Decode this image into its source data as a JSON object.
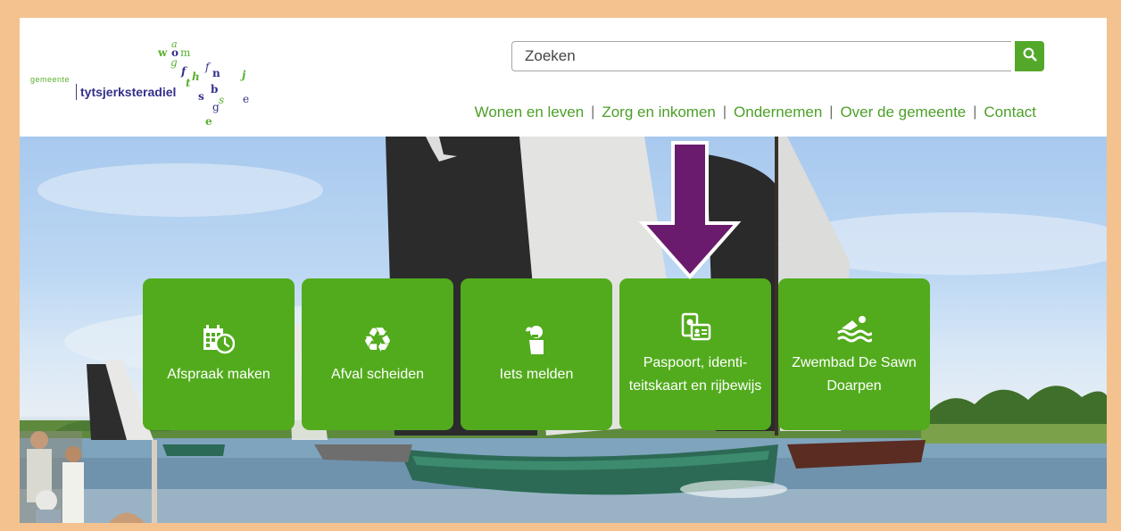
{
  "logo": {
    "prefix": "gemeente",
    "name": "tytsjerksteradiel",
    "letters": [
      "w",
      "a",
      "o",
      "m",
      "g",
      "f",
      "h",
      "f",
      "n",
      "j",
      "t",
      "s",
      "b",
      "s",
      "e",
      "g",
      "e"
    ]
  },
  "search": {
    "placeholder": "Zoeken",
    "value": ""
  },
  "nav": {
    "items": [
      "Wonen en leven",
      "Zorg en inkomen",
      "Ondernemen",
      "Over de gemeente",
      "Contact"
    ]
  },
  "tiles": [
    {
      "label": "Afspraak maken",
      "icon": "calendar-clock-icon"
    },
    {
      "label": "Afval scheiden",
      "icon": "recycle-icon"
    },
    {
      "label": "Iets melden",
      "icon": "person-speech-icon"
    },
    {
      "label": "Paspoort, identi-teitskaart en rijbewijs",
      "icon": "id-card-icon"
    },
    {
      "label": "Zwembad De Sawn Doarpen",
      "icon": "swimmer-icon"
    }
  ],
  "colors": {
    "brand_green": "#52ab1d",
    "nav_green": "#4c9f28",
    "logo_purple": "#33308a",
    "frame_orange": "#f4c28e",
    "arrow_purple": "#6b1b6e"
  }
}
